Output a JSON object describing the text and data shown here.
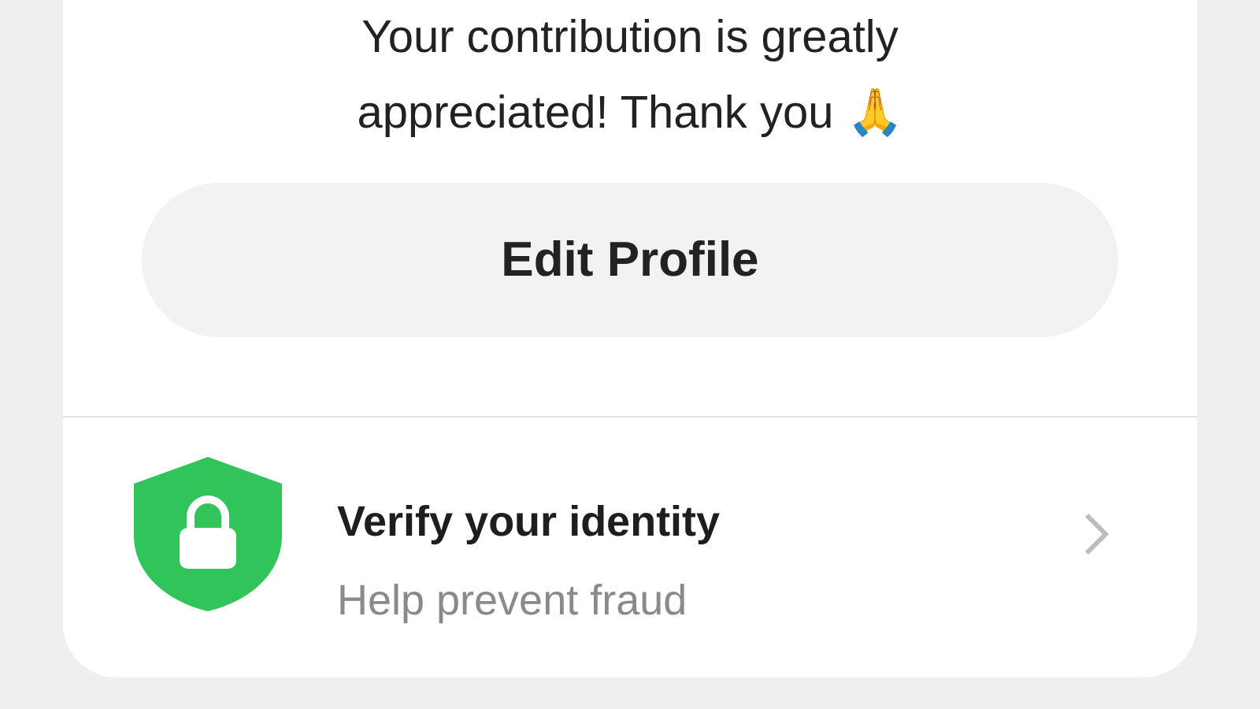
{
  "message": "Your contribution is greatly appreciated! Thank you 🙏",
  "edit_button": {
    "label": "Edit Profile"
  },
  "verify_row": {
    "title": "Verify your identity",
    "subtitle": "Help prevent fraud"
  }
}
